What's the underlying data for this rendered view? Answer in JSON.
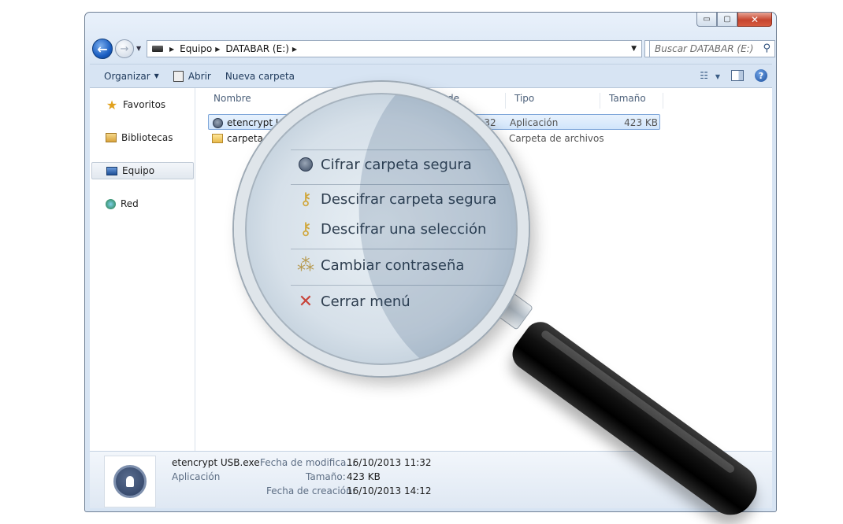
{
  "window": {
    "caption_buttons": {
      "minimize": "▭",
      "maximize": "▢",
      "close": "✕"
    }
  },
  "navbar": {
    "back_glyph": "←",
    "forward_glyph": "→",
    "history_glyph": "▼",
    "breadcrumb": [
      "Equipo",
      "DATABAR (E:)"
    ],
    "crumb_sep": "▶",
    "dropdown_glyph": "▼",
    "refresh_glyph": "↻",
    "search_placeholder": "Buscar DATABAR (E:)",
    "search_glyph": "⚲"
  },
  "toolbar": {
    "organize_label": "Organizar",
    "organize_arrow": "▼",
    "open_label": "Abrir",
    "new_folder_label": "Nueva carpeta",
    "view_glyph": "☷",
    "view_arrow": "▼",
    "help_glyph": "?"
  },
  "nav_pane": {
    "favorites": "Favoritos",
    "libraries": "Bibliotecas",
    "computer": "Equipo",
    "network": "Red"
  },
  "columns": {
    "name": "Nombre",
    "date": "Fecha de modifica...",
    "type": "Tipo",
    "size": "Tamaño"
  },
  "files": [
    {
      "name": "etencrypt USB",
      "date": "11:32",
      "type": "Aplicación",
      "size": "423 KB"
    },
    {
      "name": "carpeta",
      "date": "",
      "type": "Carpeta de archivos",
      "size": ""
    }
  ],
  "context_menu": {
    "items": [
      "Cifrar carpeta segura",
      "Descifrar carpeta segura",
      "Descifrar una selección",
      "Cambiar contraseña",
      "Cerrar menú"
    ],
    "icons": {
      "key": "⚷",
      "close": "✕",
      "bits": "⁂"
    }
  },
  "details": {
    "file_name": "etencrypt USB.exe",
    "file_kind": "Aplicación",
    "modified_label": "Fecha de modifica...",
    "modified_value": "16/10/2013 11:32",
    "size_label": "Tamaño:",
    "size_value": "423 KB",
    "created_label": "Fecha de creación:",
    "created_value": "16/10/2013 14:12"
  }
}
